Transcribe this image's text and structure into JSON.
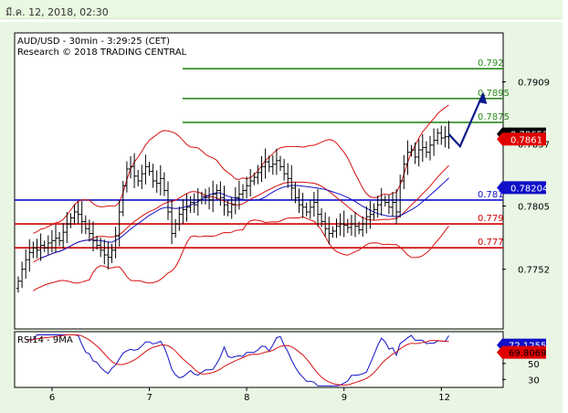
{
  "banner": {
    "text": "มี.ค. 12, 2018, 02:30"
  },
  "chart_data": [
    {
      "type": "line",
      "subtype": "candlestick-bars",
      "title": "AUD/USD - 30min - 3:29:25 (CET)",
      "subtitle": "Research © 2018 TRADING CENTRAL",
      "x_tick_labels": [
        "6",
        "7",
        "8",
        "9",
        "12"
      ],
      "y_tick_labels": [
        "0.7909",
        "0.7857",
        "0.7805",
        "0.7752"
      ],
      "ylim": [
        0.7702,
        0.795
      ],
      "price_tags": [
        {
          "label": "0.78653",
          "value": 0.78653,
          "bg": "#000000",
          "fg": "#ffffff"
        },
        {
          "label": "0.7861",
          "value": 0.7861,
          "bg": "#e00000",
          "fg": "#ffffff"
        },
        {
          "label": "0.78204",
          "value": 0.78204,
          "bg": "#1010c8",
          "fg": "#ffffff"
        }
      ],
      "levels": [
        {
          "label": "0.792",
          "value": 0.792,
          "color": "#2a8a1a"
        },
        {
          "label": "0.7895",
          "value": 0.7895,
          "color": "#2a8a1a"
        },
        {
          "label": "0.7875",
          "value": 0.7875,
          "color": "#2a8a1a"
        },
        {
          "label": "0.781",
          "value": 0.781,
          "color": "#1010c8"
        },
        {
          "label": "0.779",
          "value": 0.779,
          "color": "#d00000"
        },
        {
          "label": "0.777",
          "value": 0.777,
          "color": "#d00000"
        }
      ],
      "close_series": [
        0.7742,
        0.7752,
        0.776,
        0.7766,
        0.777,
        0.7768,
        0.7772,
        0.777,
        0.7774,
        0.7776,
        0.7778,
        0.7776,
        0.7783,
        0.779,
        0.7795,
        0.78,
        0.7798,
        0.7792,
        0.7786,
        0.7782,
        0.7776,
        0.7772,
        0.7768,
        0.7764,
        0.7762,
        0.7768,
        0.778,
        0.78,
        0.7822,
        0.7836,
        0.7838,
        0.783,
        0.7826,
        0.7832,
        0.7838,
        0.7834,
        0.7826,
        0.7824,
        0.7828,
        0.7818,
        0.78,
        0.7782,
        0.779,
        0.7798,
        0.7802,
        0.7804,
        0.7808,
        0.7806,
        0.781,
        0.7813,
        0.7812,
        0.781,
        0.7815,
        0.7818,
        0.7812,
        0.7806,
        0.78,
        0.7806,
        0.7812,
        0.7815,
        0.7818,
        0.7822,
        0.7826,
        0.7829,
        0.7833,
        0.7838,
        0.7842,
        0.7838,
        0.784,
        0.7843,
        0.7838,
        0.7832,
        0.7828,
        0.782,
        0.7812,
        0.7806,
        0.7804,
        0.78,
        0.7804,
        0.7808,
        0.7798,
        0.7792,
        0.7786,
        0.7782,
        0.7784,
        0.7788,
        0.779,
        0.7789,
        0.7787,
        0.779,
        0.7788,
        0.7785,
        0.779,
        0.7796,
        0.7798,
        0.7802,
        0.7806,
        0.781,
        0.7808,
        0.7804,
        0.7808,
        0.78,
        0.7826,
        0.784,
        0.785,
        0.7852,
        0.7846,
        0.7852,
        0.7854,
        0.785,
        0.7856,
        0.786,
        0.7866,
        0.7862,
        0.7863,
        0.7865
      ],
      "projection": [
        {
          "bar": 115,
          "value": 0.7865
        },
        {
          "bar": 118,
          "value": 0.7855
        },
        {
          "bar": 124,
          "value": 0.7898
        }
      ]
    },
    {
      "type": "line",
      "title": "RSI14 - 9MA",
      "y_tick_labels": [
        "70",
        "50",
        "30"
      ],
      "ylim": [
        20,
        90
      ],
      "value_tags": [
        {
          "label": "72.1255",
          "value": 72.1255,
          "bg": "#1010c8",
          "fg": "#ffffff"
        },
        {
          "label": "69.8069",
          "value": 69.8069,
          "bg": "#e00000",
          "fg": "#000000"
        }
      ]
    }
  ]
}
